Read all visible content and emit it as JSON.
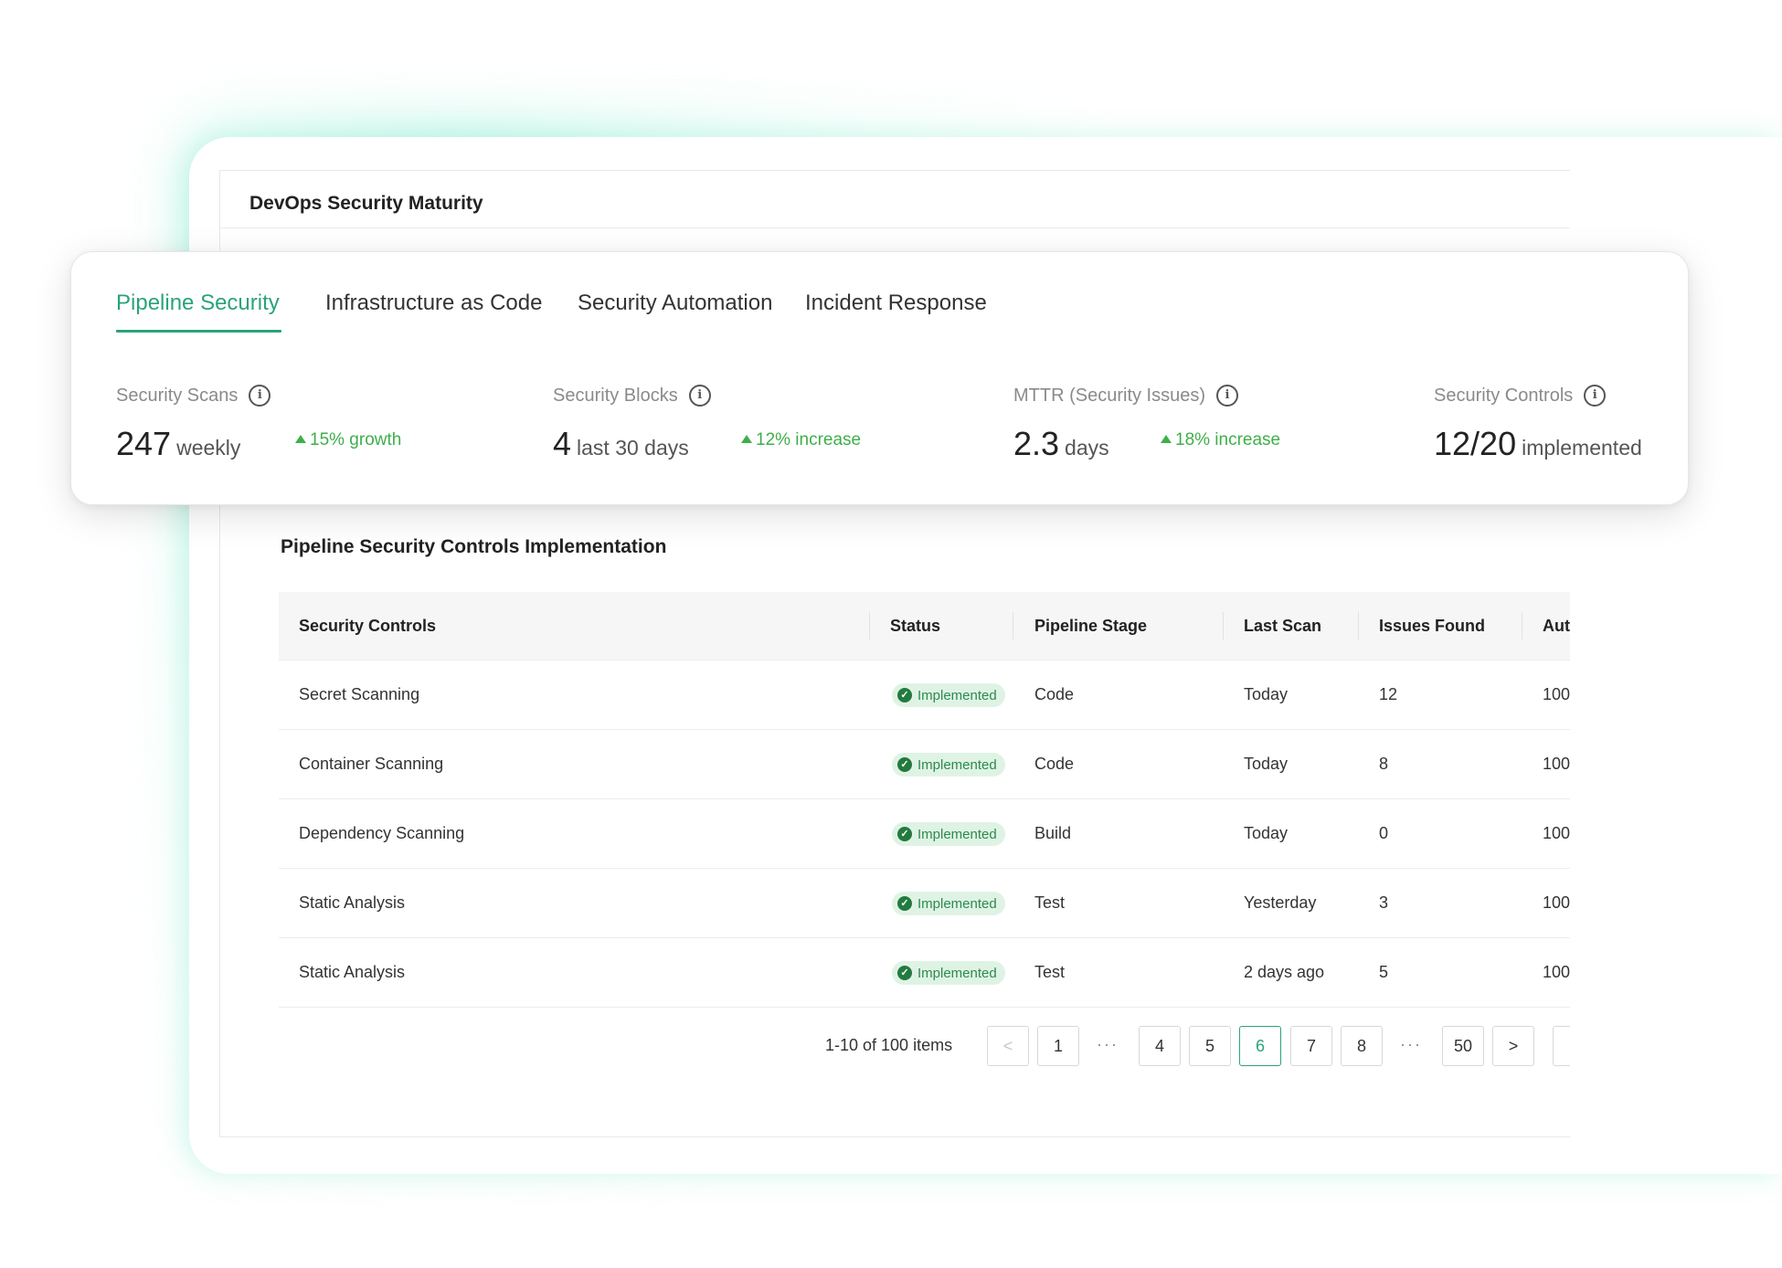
{
  "page_title": "DevOps Security Maturity",
  "tabs": [
    {
      "label": "Pipeline Security"
    },
    {
      "label": "Infrastructure as Code"
    },
    {
      "label": "Security Automation"
    },
    {
      "label": "Incident Response"
    }
  ],
  "metrics": [
    {
      "label": "Security Scans",
      "value": "247",
      "unit": "weekly",
      "delta": "15% growth",
      "icon": "info-icon"
    },
    {
      "label": "Security Blocks",
      "value": "4",
      "unit": "last 30 days",
      "delta": "12% increase",
      "icon": "info-icon"
    },
    {
      "label": "MTTR (Security Issues)",
      "value": "2.3",
      "unit": "days",
      "delta": "18% increase",
      "icon": "info-icon"
    },
    {
      "label": "Security Controls",
      "value": "12/20",
      "unit": "implemented",
      "icon": "info-icon"
    }
  ],
  "section_title": "Pipeline Security Controls Implementation",
  "table": {
    "columns": [
      "Security Controls",
      "Status",
      "Pipeline Stage",
      "Last Scan",
      "Issues Found",
      "Aut"
    ],
    "rows": [
      {
        "control": "Secret Scanning",
        "status": "Implemented",
        "stage": "Code",
        "last_scan": "Today",
        "issues": "12",
        "aut": "100"
      },
      {
        "control": "Container Scanning",
        "status": "Implemented",
        "stage": "Code",
        "last_scan": "Today",
        "issues": "8",
        "aut": "100"
      },
      {
        "control": "Dependency Scanning",
        "status": "Implemented",
        "stage": "Build",
        "last_scan": "Today",
        "issues": "0",
        "aut": "100"
      },
      {
        "control": "Static Analysis",
        "status": "Implemented",
        "stage": "Test",
        "last_scan": "Yesterday",
        "issues": "3",
        "aut": "100"
      },
      {
        "control": "Static Analysis",
        "status": "Implemented",
        "stage": "Test",
        "last_scan": "2 days ago",
        "issues": "5",
        "aut": "100"
      }
    ]
  },
  "pagination": {
    "info": "1-10 of 100 items",
    "prev": "<",
    "next": ">",
    "pages": [
      "1",
      "4",
      "5",
      "6",
      "7",
      "8",
      "50"
    ],
    "ellipsis": "···",
    "active": "6"
  },
  "colors": {
    "accent": "#2aa37a",
    "positive": "#3fae4a",
    "badge_bg": "#dff3e5",
    "badge_text": "#2d8a4e"
  }
}
